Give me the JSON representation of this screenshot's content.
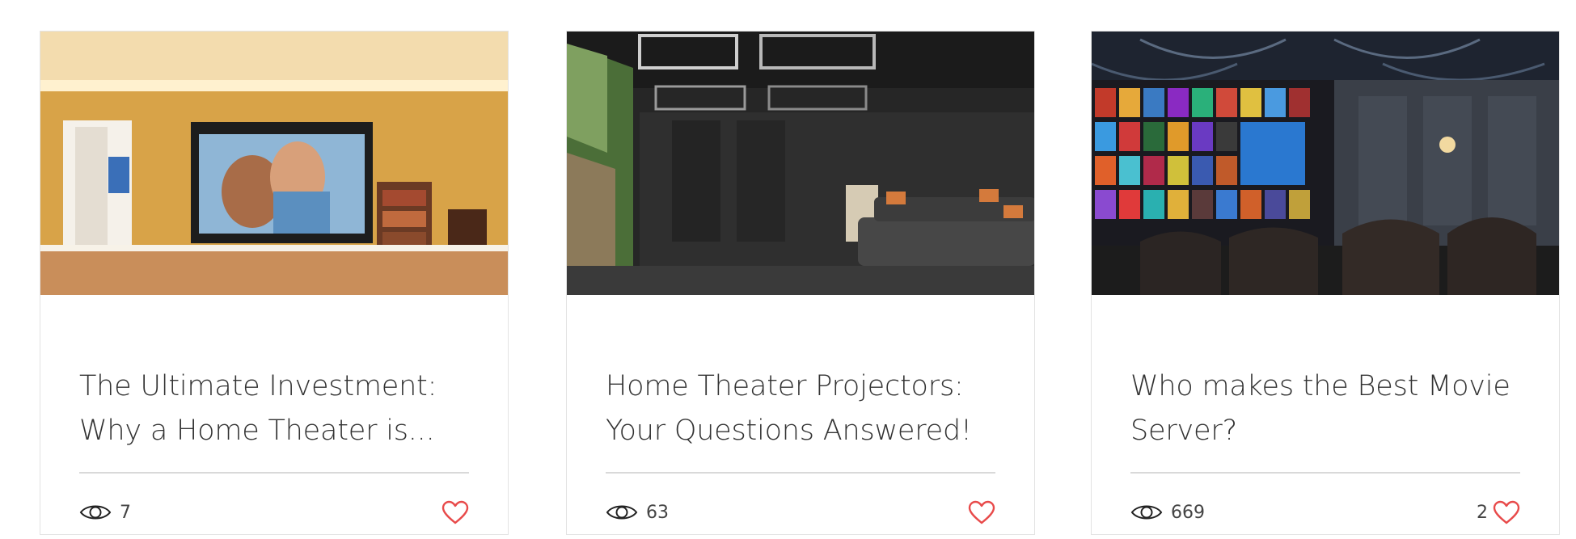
{
  "accent_color": "#e84a4a",
  "posts": [
    {
      "title": "The Ultimate Investment: Why a Home Theater is...",
      "image": "living-room-projector-screen",
      "views": "7",
      "likes": ""
    },
    {
      "title": "Home Theater Projectors: Your Questions Answered!",
      "image": "dark-theater-room-sectional-sofa",
      "views": "63",
      "likes": ""
    },
    {
      "title": "Who makes the Best Movie Server?",
      "image": "theater-with-movie-poster-wall",
      "views": "669",
      "likes": "2"
    }
  ]
}
